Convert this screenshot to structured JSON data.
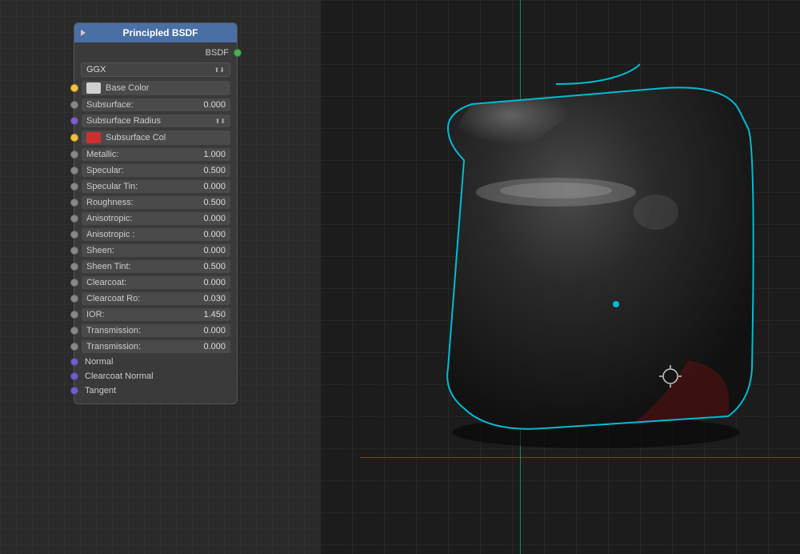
{
  "node": {
    "title": "Principled BSDF",
    "header_color": "#4a6fa5",
    "output_label": "BSDF",
    "distribution": "GGX",
    "fields": [
      {
        "name": "Base Color",
        "socket_color": "yellow",
        "has_swatch": true,
        "swatch_color": "#d0d0d0",
        "value": ""
      },
      {
        "name": "Subsurface:",
        "socket_color": "grey",
        "has_swatch": false,
        "value": "0.000"
      },
      {
        "name": "Subsurface Radius",
        "socket_color": "purple",
        "has_swatch": false,
        "value": "",
        "is_dropdown": true
      },
      {
        "name": "Subsurface Col",
        "socket_color": "yellow",
        "has_swatch": true,
        "swatch_color": "#d03030",
        "value": ""
      },
      {
        "name": "Metallic:",
        "socket_color": "grey",
        "has_swatch": false,
        "value": "1.000"
      },
      {
        "name": "Specular:",
        "socket_color": "grey",
        "has_swatch": false,
        "value": "0.500"
      },
      {
        "name": "Specular Tin:",
        "socket_color": "grey",
        "has_swatch": false,
        "value": "0.000"
      },
      {
        "name": "Roughness:",
        "socket_color": "grey",
        "has_swatch": false,
        "value": "0.500"
      },
      {
        "name": "Anisotropic:",
        "socket_color": "grey",
        "has_swatch": false,
        "value": "0.000"
      },
      {
        "name": "Anisotropic :",
        "socket_color": "grey",
        "has_swatch": false,
        "value": "0.000"
      },
      {
        "name": "Sheen:",
        "socket_color": "grey",
        "has_swatch": false,
        "value": "0.000"
      },
      {
        "name": "Sheen Tint:",
        "socket_color": "grey",
        "has_swatch": false,
        "value": "0.500"
      },
      {
        "name": "Clearcoat:",
        "socket_color": "grey",
        "has_swatch": false,
        "value": "0.000"
      },
      {
        "name": "Clearcoat Ro:",
        "socket_color": "grey",
        "has_swatch": false,
        "value": "0.030"
      },
      {
        "name": "IOR:",
        "socket_color": "grey",
        "has_swatch": false,
        "value": "1.450"
      },
      {
        "name": "Transmission:",
        "socket_color": "grey",
        "has_swatch": false,
        "value": "0.000"
      },
      {
        "name": "Transmission:",
        "socket_color": "grey",
        "has_swatch": false,
        "value": "0.000"
      }
    ],
    "bottom_sockets": [
      {
        "label": "Normal"
      },
      {
        "label": "Clearcoat Normal"
      },
      {
        "label": "Tangent"
      }
    ]
  },
  "viewport": {
    "background_color": "#1c1c1c"
  }
}
